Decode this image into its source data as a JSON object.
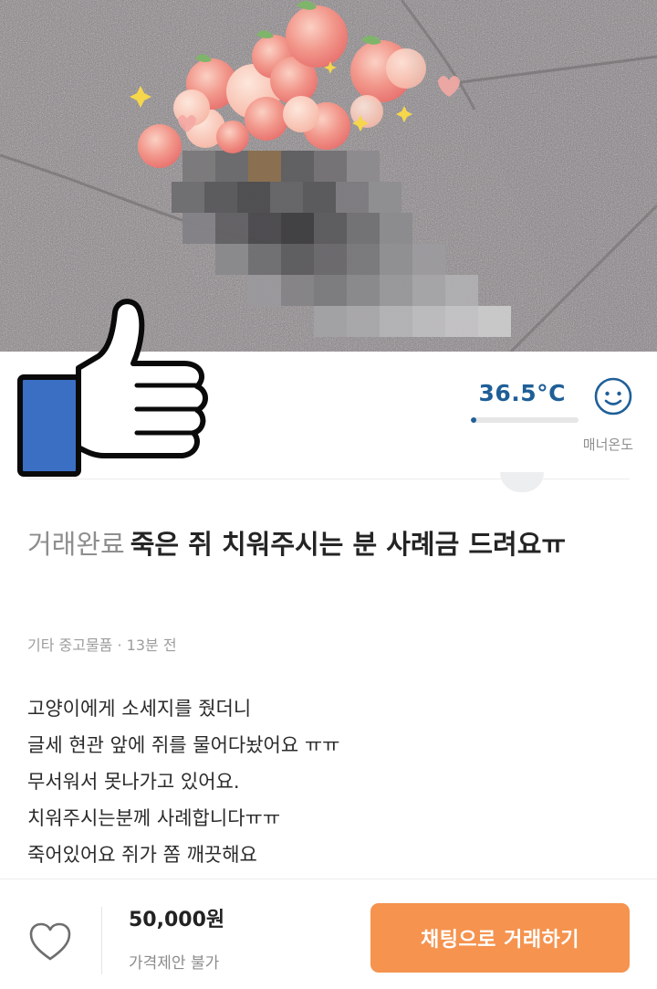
{
  "profile": {
    "manner_temperature": "36.5°C",
    "manner_temperature_label": "매너온도",
    "manner_temperature_value": 36.5,
    "manner_temperature_fill_fraction": 0.05,
    "temperature_color": "#1f5f98",
    "face_icon": "smiling-face-icon"
  },
  "post": {
    "status": "거래완료",
    "title": "죽은 쥐 치워주시는 분 사례금 드려요ㅠ",
    "category": "기타 중고물품",
    "time_ago": "13분 전",
    "meta_separator": " · ",
    "description_lines": [
      "고양이에게 소세지를 줬더니",
      "글세 현관 앞에 쥐를 물어다놨어요 ㅠㅠ",
      "무서워서 못나가고 있어요.",
      "치워주시는분께 사례합니다ㅠㅠ",
      "죽어있어요 쥐가 쫌 깨끗해요"
    ]
  },
  "bottom_bar": {
    "price": "50,000원",
    "price_negotiation": "가격제안 불가",
    "chat_button_label": "채팅으로 거래하기",
    "accent_color": "#f5934f",
    "heart_icon": "heart-outline-icon"
  },
  "overlays": {
    "thumbs_up_icon": "thumbs-up-icon",
    "peach_stickers": "peach-sticker-icon",
    "mosaic": "pixelated-censor"
  }
}
